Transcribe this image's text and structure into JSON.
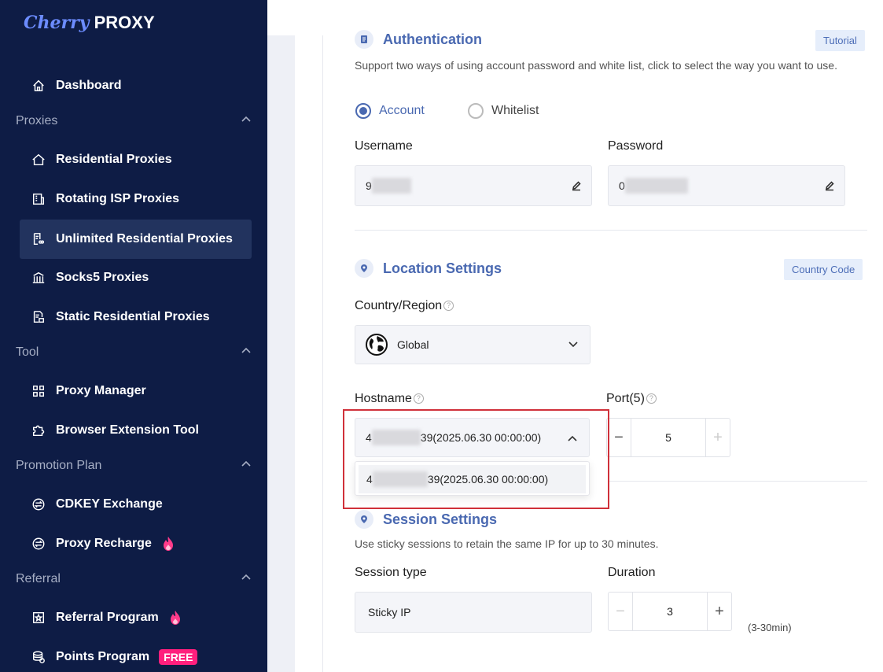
{
  "brand": {
    "part1": "Cherry",
    "part2": "PROXY"
  },
  "sidebar": {
    "dashboard": "Dashboard",
    "sections": [
      {
        "label": "Proxies",
        "items": [
          "Residential Proxies",
          "Rotating ISP Proxies",
          "Unlimited Residential Proxies",
          "Socks5 Proxies",
          "Static Residential Proxies"
        ]
      },
      {
        "label": "Tool",
        "items": [
          "Proxy Manager",
          "Browser Extension Tool"
        ]
      },
      {
        "label": "Promotion Plan",
        "items": [
          "CDKEY Exchange",
          "Proxy Recharge"
        ]
      },
      {
        "label": "Referral",
        "items": [
          "Referral Program",
          "Points Program"
        ]
      }
    ],
    "active_item": "Unlimited Residential Proxies",
    "free_badge": "FREE"
  },
  "auth": {
    "title": "Authentication",
    "tutorial": "Tutorial",
    "desc": "Support two ways of using account password and white list, click to select the way you want to use.",
    "radio_account": "Account",
    "radio_whitelist": "Whitelist",
    "username_label": "Username",
    "username_prefix": "9",
    "password_label": "Password",
    "password_prefix": "0"
  },
  "location": {
    "title": "Location Settings",
    "country_code": "Country Code",
    "country_label": "Country/Region",
    "country_value": "Global",
    "hostname_label": "Hostname",
    "hostname_prefix": "4",
    "hostname_suffix": "39(2025.06.30 00:00:00)",
    "port_label": "Port(5)",
    "port_value": "5",
    "dropdown_prefix": "4",
    "dropdown_suffix": "39(2025.06.30 00:00:00)"
  },
  "session": {
    "title": "Session Settings",
    "desc": "Use sticky sessions to retain the same IP for up to 30 minutes.",
    "type_label": "Session type",
    "type_value": "Sticky IP",
    "duration_label": "Duration",
    "duration_value": "3",
    "duration_hint": "(3-30min)"
  },
  "colors": {
    "sidebar_bg": "#0e1c45",
    "accent": "#4a69b1",
    "highlight": "#d0313a",
    "badge": "#ff1f7d"
  }
}
